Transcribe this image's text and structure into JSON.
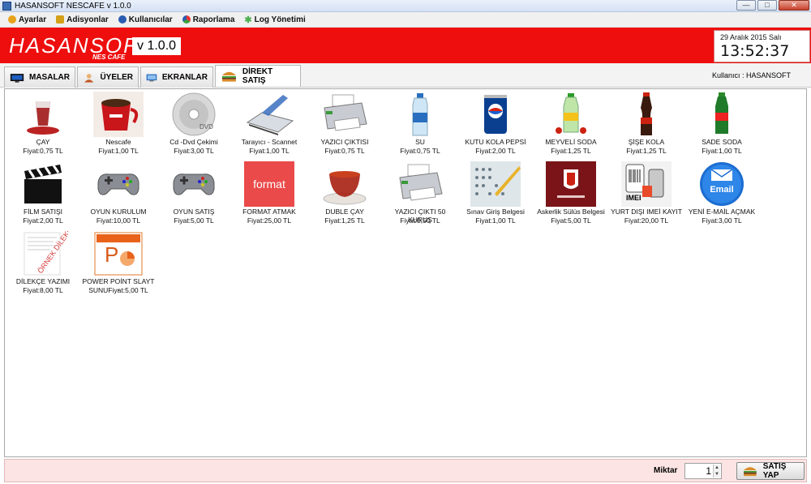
{
  "window": {
    "title": "HASANSOFT NESCAFE v 1.0.0"
  },
  "menu": [
    {
      "label": "Ayarlar",
      "icon": "gear-icon",
      "color": "#e8a21b"
    },
    {
      "label": "Adisyonlar",
      "icon": "wallet-icon",
      "color": "#d4a017"
    },
    {
      "label": "Kullanıcılar",
      "icon": "users-icon",
      "color": "#2a5db0"
    },
    {
      "label": "Raporlama",
      "icon": "chart-icon",
      "color": "#3aa23a"
    },
    {
      "label": "Log Yönetimi",
      "icon": "log-icon",
      "color": "#4caf50"
    }
  ],
  "header": {
    "logo": "HASANSOFT",
    "logo_sub": "NES CAFE",
    "version": "v 1.0.0",
    "accent": "#ee0e0e"
  },
  "clock": {
    "date": "29 Aralık 2015 Salı",
    "time": "13:52:37"
  },
  "tabs": [
    {
      "label": "MASALAR",
      "icon": "monitor-icon"
    },
    {
      "label": "ÜYELER",
      "icon": "user-icon"
    },
    {
      "label": "EKRANLAR",
      "icon": "screen-icon"
    },
    {
      "label": "DİREKT SATIŞ",
      "icon": "burger-icon",
      "active": true
    }
  ],
  "user": {
    "label": "Kullanıcı : HASANSOFT"
  },
  "products": [
    {
      "name": "ÇAY",
      "price": "Fiyat:0,75 TL",
      "icon": "tea-glass-icon"
    },
    {
      "name": "Nescafe",
      "price": "Fiyat:1,00 TL",
      "icon": "coffee-cup-icon"
    },
    {
      "name": "Cd -Dvd Çekimi",
      "price": "Fiyat:3,00 TL",
      "icon": "dvd-icon"
    },
    {
      "name": "Tarayıcı - Scannet",
      "price": "Fiyat:1,00 TL",
      "icon": "scanner-icon"
    },
    {
      "name": "YAZICI ÇIKTISI",
      "price": "Fiyat:0,75 TL",
      "icon": "printer-icon"
    },
    {
      "name": "SU",
      "price": "Fiyat:0,75 TL",
      "icon": "water-bottle-icon"
    },
    {
      "name": "KUTU KOLA PEPSİ",
      "price": "Fiyat:2,00 TL",
      "icon": "pepsi-can-icon"
    },
    {
      "name": "MEYVELİ SODA",
      "price": "Fiyat:1,25 TL",
      "icon": "fruit-soda-icon"
    },
    {
      "name": "ŞİŞE KOLA",
      "price": "Fiyat:1,25 TL",
      "icon": "cola-bottle-icon"
    },
    {
      "name": "SADE SODA",
      "price": "Fiyat:1,00 TL",
      "icon": "soda-bottle-icon"
    },
    {
      "name": "FİLM SATIŞI",
      "price": "Fiyat:2,00 TL",
      "icon": "clapperboard-icon"
    },
    {
      "name": "OYUN KURULUM",
      "price": "Fiyat:10,00 TL",
      "icon": "gamepad-icon"
    },
    {
      "name": "OYUN SATIŞ",
      "price": "Fiyat:5,00 TL",
      "icon": "gamepad-icon"
    },
    {
      "name": "FORMAT ATMAK",
      "price": "Fiyat:25,00 TL",
      "icon": "format-icon",
      "icon_text": "format"
    },
    {
      "name": "DUBLE ÇAY",
      "price": "Fiyat:1,25 TL",
      "icon": "tea-cup-icon"
    },
    {
      "name": "YAZICI ÇIKTI 50 KURUŞ",
      "price": "Fiyat:0,50 TL",
      "icon": "printer-icon"
    },
    {
      "name": "Sınav Giriş Belgesi",
      "price": "Fiyat:1,00 TL",
      "icon": "exam-sheet-icon"
    },
    {
      "name": "Askerlik Sülüs Belgesi",
      "price": "Fiyat:5,00 TL",
      "icon": "military-doc-icon"
    },
    {
      "name": "YURT DIŞI IMEİ KAYIT",
      "price": "Fiyat:20,00 TL",
      "icon": "imei-icon",
      "icon_text": "IMEI"
    },
    {
      "name": "YENİ E-MAİL AÇMAK",
      "price": "Fiyat:3,00 TL",
      "icon": "email-icon",
      "icon_text": "Email"
    },
    {
      "name": "DİLEKÇE YAZIMI",
      "price": "Fiyat:8,00 TL",
      "icon": "petition-icon"
    },
    {
      "name": "POWER POİNT SLAYT -",
      "name2": "SUNUFiyat:5,00 TL",
      "icon": "powerpoint-icon"
    }
  ],
  "footer": {
    "miktar_label": "Miktar",
    "quantity": "1",
    "sell_label": "SATIŞ YAP",
    "sell_icon": "burger-icon"
  }
}
